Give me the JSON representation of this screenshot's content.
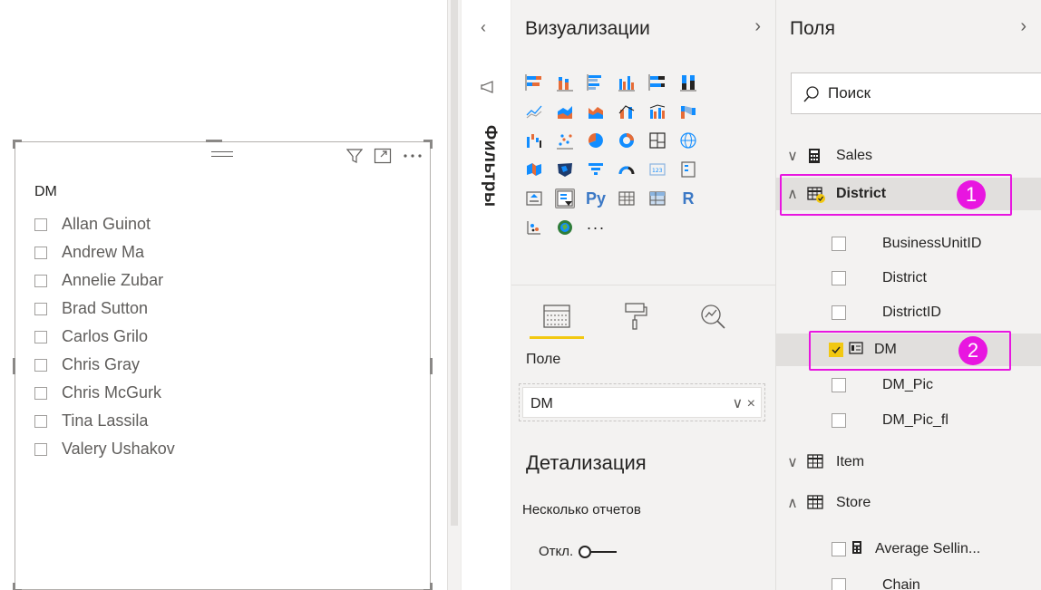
{
  "slicer": {
    "title": "DM",
    "items": [
      {
        "label": "Allan Guinot"
      },
      {
        "label": "Andrew Ma"
      },
      {
        "label": "Annelie Zubar"
      },
      {
        "label": "Brad Sutton"
      },
      {
        "label": "Carlos Grilo"
      },
      {
        "label": "Chris Gray"
      },
      {
        "label": "Chris McGurk"
      },
      {
        "label": "Tina Lassila"
      },
      {
        "label": "Valery Ushakov"
      }
    ],
    "header_icons": [
      "filter-icon",
      "focus-mode-icon",
      "more-options-icon"
    ]
  },
  "filters": {
    "label": "Фильтры",
    "collapse_chevron": "‹"
  },
  "visualizations": {
    "title": "Визуализации",
    "chevron": "›",
    "icons": [
      "stacked-bar-chart-icon",
      "stacked-column-chart-icon",
      "clustered-bar-chart-icon",
      "clustered-column-chart-icon",
      "100-stacked-bar-chart-icon",
      "100-stacked-column-chart-icon",
      "line-chart-icon",
      "area-chart-icon",
      "stacked-area-chart-icon",
      "line-and-stacked-column-chart-icon",
      "line-and-clustered-column-chart-icon",
      "ribbon-chart-icon",
      "waterfall-chart-icon",
      "scatter-chart-icon",
      "pie-chart-icon",
      "donut-chart-icon",
      "treemap-icon",
      "map-icon",
      "filled-map-icon",
      "shape-map-icon",
      "funnel-icon",
      "gauge-icon",
      "card-icon",
      "multi-row-card-icon",
      "kpi-icon",
      "slicer-icon",
      "python-visual-icon",
      "table-icon",
      "matrix-icon",
      "r-visual-icon",
      "key-influencers-icon",
      "arcgis-map-icon",
      "more-visuals-icon"
    ],
    "python_label": "Py",
    "r_label": "R",
    "more_label": "···",
    "tabs": [
      "fields-tab-icon",
      "format-tab-icon",
      "analytics-tab-icon"
    ],
    "field_well_label": "Поле",
    "field_value": "DM",
    "field_controls": "∨ ×",
    "drill_title": "Детализация",
    "cross_report_label": "Несколько отчетов",
    "toggle_label": "Откл."
  },
  "fields": {
    "title": "Поля",
    "chevron": "›",
    "search_placeholder": "Поиск",
    "rows": [
      {
        "kind": "table",
        "expanded": false,
        "label": "Sales",
        "icon": "calculator-icon"
      },
      {
        "kind": "table",
        "expanded": true,
        "label": "District",
        "icon": "table-icon",
        "selected": true
      },
      {
        "kind": "field",
        "label": "BusinessUnitID",
        "checked": false
      },
      {
        "kind": "field",
        "label": "District",
        "checked": false
      },
      {
        "kind": "field",
        "label": "DistrictID",
        "checked": false
      },
      {
        "kind": "field",
        "label": "DM",
        "checked": true
      },
      {
        "kind": "field",
        "label": "DM_Pic",
        "checked": false
      },
      {
        "kind": "field",
        "label": "DM_Pic_fl",
        "checked": false
      },
      {
        "kind": "table",
        "expanded": false,
        "label": "Item",
        "icon": "table-icon"
      },
      {
        "kind": "table",
        "expanded": true,
        "label": "Store",
        "icon": "table-icon"
      },
      {
        "kind": "field",
        "label": "Average Sellin...",
        "checked": false,
        "measure": true
      },
      {
        "kind": "field",
        "label": "Chain",
        "checked": false
      }
    ]
  },
  "callouts": [
    {
      "number": "1",
      "color": "#e816e0"
    },
    {
      "number": "2",
      "color": "#e816e0"
    }
  ],
  "colors": {
    "accent_yellow": "#f2c811",
    "callout_magenta": "#e816e0",
    "pane_bg": "#f3f2f1"
  }
}
